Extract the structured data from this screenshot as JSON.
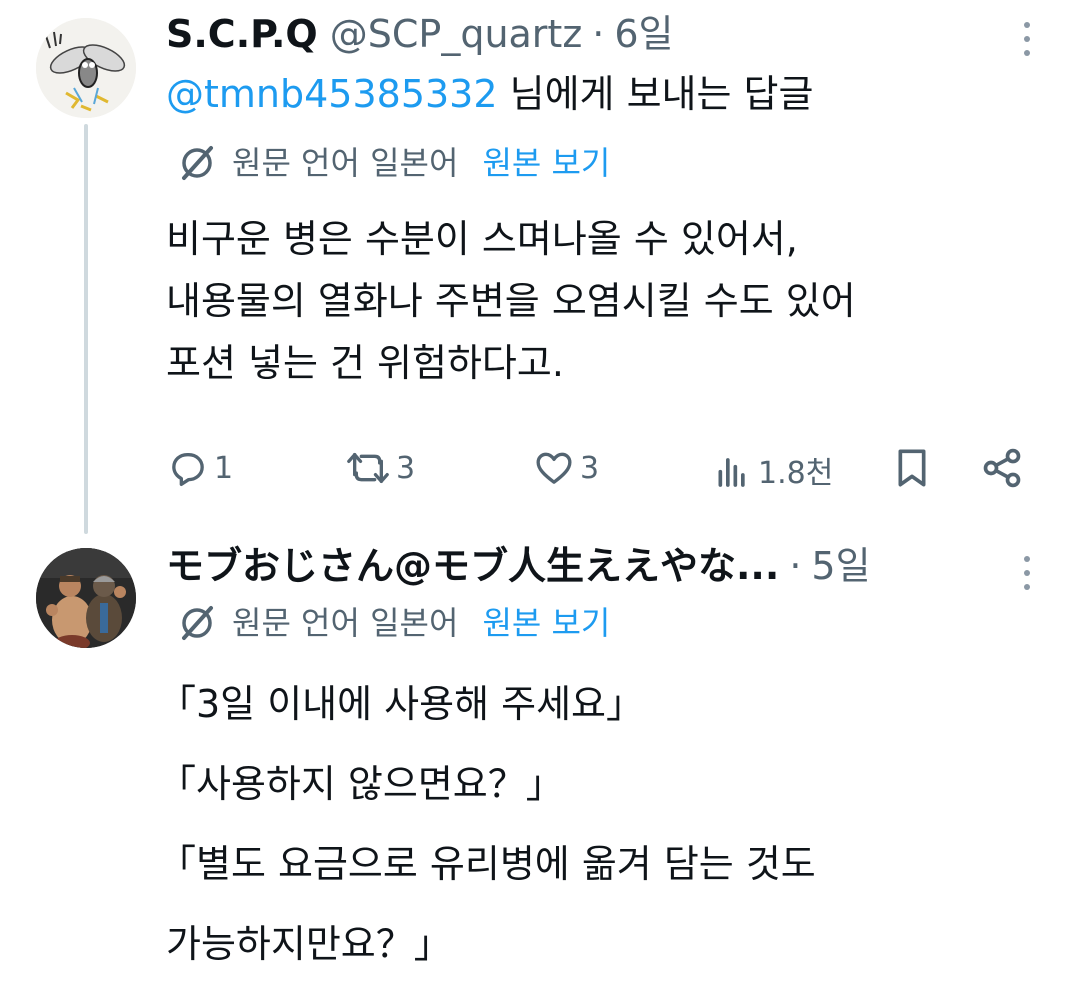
{
  "tweets": [
    {
      "display_name": "S.C.P.Q",
      "handle": "@SCP_quartz",
      "separator": "·",
      "time": "6일",
      "reply_mention": "@tmnb45385332",
      "reply_suffix": " 님에게 보내는 답글",
      "translation_label": "원문 언어 일본어",
      "view_original": "원본 보기",
      "lines": [
        "비구운 병은 수분이 스며나올 수 있어서,",
        "내용물의 열화나 주변을 오염시킬 수도 있어",
        "포션 넣는 건 위험하다고."
      ],
      "stats": {
        "replies": "1",
        "reposts": "3",
        "likes": "3",
        "views": "1.8천"
      },
      "icons": [
        "reply-icon",
        "repost-icon",
        "like-icon",
        "views-icon",
        "bookmark-icon",
        "share-icon",
        "more-icon",
        "translate-icon"
      ]
    },
    {
      "display_name": "モブおじさん@モブ人生ええやな...",
      "separator": "·",
      "time": "5일",
      "translation_label": "원문 언어 일본어",
      "view_original": "원본 보기",
      "lines": [
        "「3일 이내에 사용해 주세요」",
        "「사용하지 않으면요？」",
        "「별도 요금으로 유리병에 옮겨 담는 것도",
        "가능하지만요？」"
      ]
    }
  ],
  "colors": {
    "text": "#0f1419",
    "secondary": "#536471",
    "link": "#1d9bf0",
    "thread_line": "#cfd9de"
  }
}
